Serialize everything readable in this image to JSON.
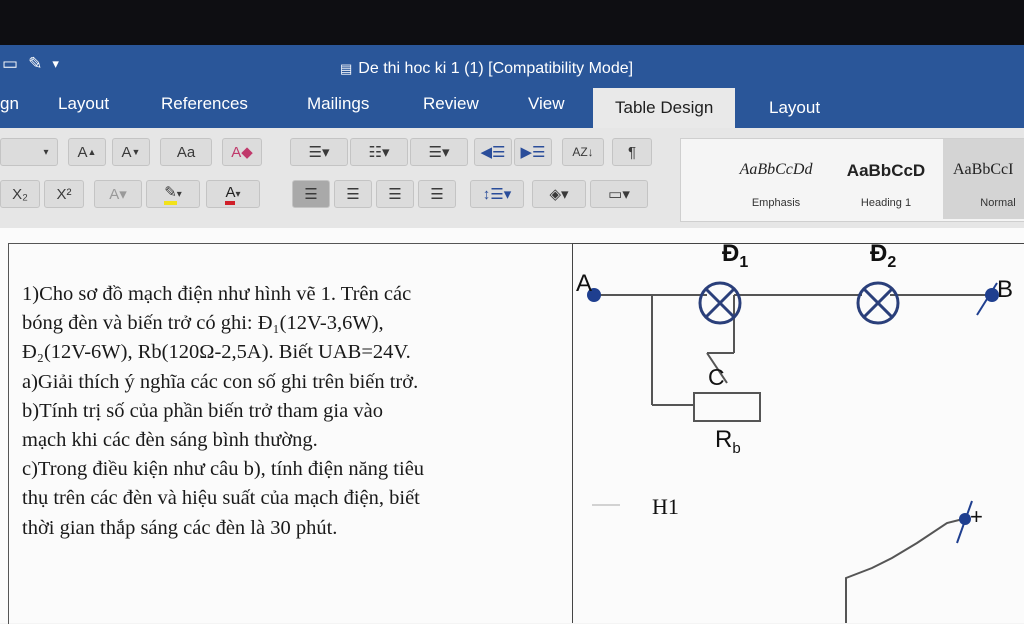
{
  "window": {
    "title": "De thi hoc ki 1 (1) [Compatibility Mode]"
  },
  "tabs": [
    {
      "label": "gn"
    },
    {
      "label": "Layout"
    },
    {
      "label": "References"
    },
    {
      "label": "Mailings"
    },
    {
      "label": "Review"
    },
    {
      "label": "View"
    },
    {
      "label": "Table Design"
    },
    {
      "label": "Layout"
    }
  ],
  "ribbon": {
    "grow_font": "A",
    "shrink_font": "A",
    "subscript": "X₂",
    "superscript": "X²",
    "font_color": "A",
    "pilcrow": "¶"
  },
  "styles": [
    {
      "sample": "AaBbCcDd",
      "name": "Emphasis"
    },
    {
      "sample": "AaBbCcD",
      "name": "Heading 1"
    },
    {
      "sample": "AaBbCcI",
      "name": "Normal"
    }
  ],
  "document": {
    "problem_lines": [
      "1)Cho sơ đồ mạch điện như hình vẽ 1. Trên các",
      "bóng đèn và biến trở có ghi: Đ₁(12V-3,6W),",
      "Đ₂(12V-6W), Rb(120Ω-2,5A). Biết UAB=24V.",
      "a)Giải thích ý nghĩa các con số ghi trên biến trở.",
      "b)Tính trị số của phần biến trở tham gia vào",
      "mạch khi các đèn sáng bình thường.",
      "c)Trong điều kiện như câu b), tính điện năng tiêu",
      "thụ trên các đèn và hiệu suất của mạch điện, biết",
      "thời gian thắp sáng các đèn là 30 phút."
    ]
  },
  "circuit": {
    "node_a": "A",
    "node_b": "B",
    "lamp1_label": "Đ",
    "lamp1_sub": "1",
    "lamp2_label": "Đ",
    "lamp2_sub": "2",
    "slider_label": "C",
    "rheostat_label": "R",
    "rheostat_sub": "b",
    "figure_label": "H1",
    "plus_label": "+"
  },
  "colors": {
    "ribbon_blue": "#2a5699",
    "wire": "#555555",
    "node_blue": "#1f3f8f"
  }
}
